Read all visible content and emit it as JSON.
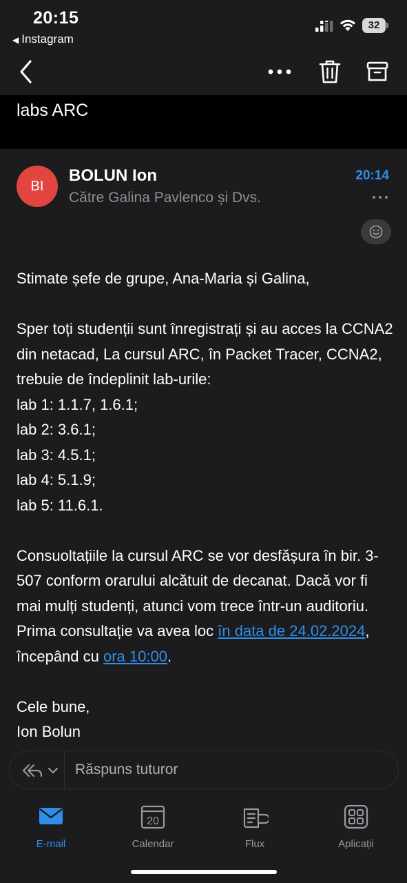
{
  "status_bar": {
    "time": "20:15",
    "back_app": "Instagram",
    "battery": "32"
  },
  "nav": {
    "icons": [
      "chevron-left-icon",
      "more-horizontal-icon",
      "trash-icon",
      "archive-icon"
    ]
  },
  "email": {
    "subject": "labs ARC",
    "avatar_initials": "BI",
    "avatar_color": "#e2453f",
    "sender": "BOLUN Ion",
    "recipients": "Către Galina Pavlenco și Dvs.",
    "time": "20:14",
    "body": {
      "greeting": "Stimate șefe de grupe, Ana-Maria și Galina,",
      "intro": "Sper toți studenții sunt înregistrați și au acces la CCNA2 din netacad, La cursul ARC,  în Packet Tracer, CCNA2, trebuie de îndeplinit lab-urile:",
      "labs": [
        "lab 1: 1.1.7, 1.6.1;",
        "lab 2: 3.6.1;",
        "lab 3: 4.5.1;",
        "lab 4: 5.1.9;",
        "lab 5: 11.6.1."
      ],
      "consult_text": "Consuoltațiile la cursul ARC se vor desfășura în bir. 3-507 conform orarului alcătuit de decanat. Dacă vor fi mai mulți studenți, atunci vom trece într-un auditoriu. Prima consultație va avea loc ",
      "date_link": "în data de 24.02.2024",
      "mid_text": ", începând cu ",
      "time_link": "ora 10:00",
      "end_text": ".",
      "closing": "Cele bune,",
      "signature": "Ion Bolun"
    }
  },
  "reply": {
    "placeholder": "Răspuns tuturor"
  },
  "tabs": [
    {
      "label": "E-mail",
      "icon": "mail-icon",
      "active": true
    },
    {
      "label": "Calendar",
      "icon": "calendar-icon",
      "active": false,
      "day": "20"
    },
    {
      "label": "Flux",
      "icon": "feed-icon",
      "active": false
    },
    {
      "label": "Aplicații",
      "icon": "apps-grid-icon",
      "active": false
    }
  ],
  "colors": {
    "accent": "#2f8ee8",
    "background": "#1c1c1e",
    "secondary_text": "#8e8e93"
  }
}
